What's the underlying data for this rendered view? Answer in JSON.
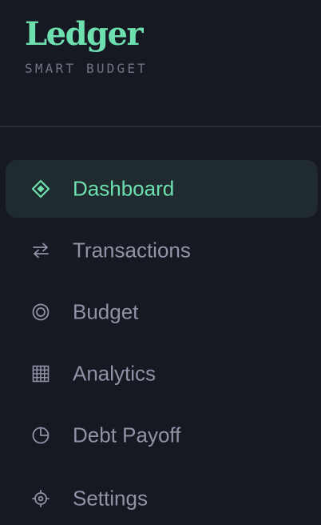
{
  "brand": {
    "title": "Ledger",
    "subtitle": "SMART BUDGET",
    "accent_color": "#6ee0b0"
  },
  "nav": {
    "active": "dashboard",
    "items": [
      {
        "id": "dashboard",
        "label": "Dashboard",
        "icon": "diamond-icon"
      },
      {
        "id": "transactions",
        "label": "Transactions",
        "icon": "swap-arrows-icon"
      },
      {
        "id": "budget",
        "label": "Budget",
        "icon": "target-icon"
      },
      {
        "id": "analytics",
        "label": "Analytics",
        "icon": "grid-icon"
      },
      {
        "id": "debt-payoff",
        "label": "Debt Payoff",
        "icon": "pie-clock-icon"
      },
      {
        "id": "settings",
        "label": "Settings",
        "icon": "gear-icon"
      }
    ]
  },
  "colors": {
    "background": "#161922",
    "active_background": "#1f2b2f",
    "inactive_text": "#8f93a6",
    "muted_text": "#6f7585"
  }
}
